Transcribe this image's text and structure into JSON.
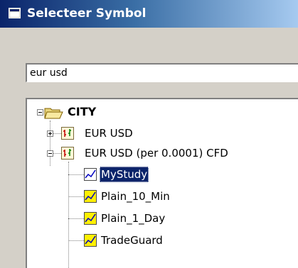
{
  "window": {
    "title": "Selecteer Symbol"
  },
  "search": {
    "value": "eur usd"
  },
  "tree": {
    "root": {
      "label": "CITY",
      "expanded": true,
      "icon": "open-folder-icon"
    },
    "instruments": [
      {
        "label": "EUR USD",
        "expanded": false,
        "icon": "instrument-chart-icon"
      },
      {
        "label": "EUR USD (per 0.0001) CFD",
        "expanded": true,
        "icon": "instrument-chart-icon"
      }
    ],
    "studies": [
      {
        "label": "MyStudy",
        "selected": true,
        "icon": "study-icon"
      },
      {
        "label": "Plain_10_Min",
        "selected": false,
        "icon": "study-icon"
      },
      {
        "label": "Plain_1_Day",
        "selected": false,
        "icon": "study-icon"
      },
      {
        "label": "TradeGuard",
        "selected": false,
        "icon": "study-icon"
      }
    ]
  },
  "colors": {
    "titlebar_start": "#0a246a",
    "titlebar_end": "#a6caf0",
    "selection": "#0a246a",
    "dialog_face": "#d4d0c8"
  }
}
